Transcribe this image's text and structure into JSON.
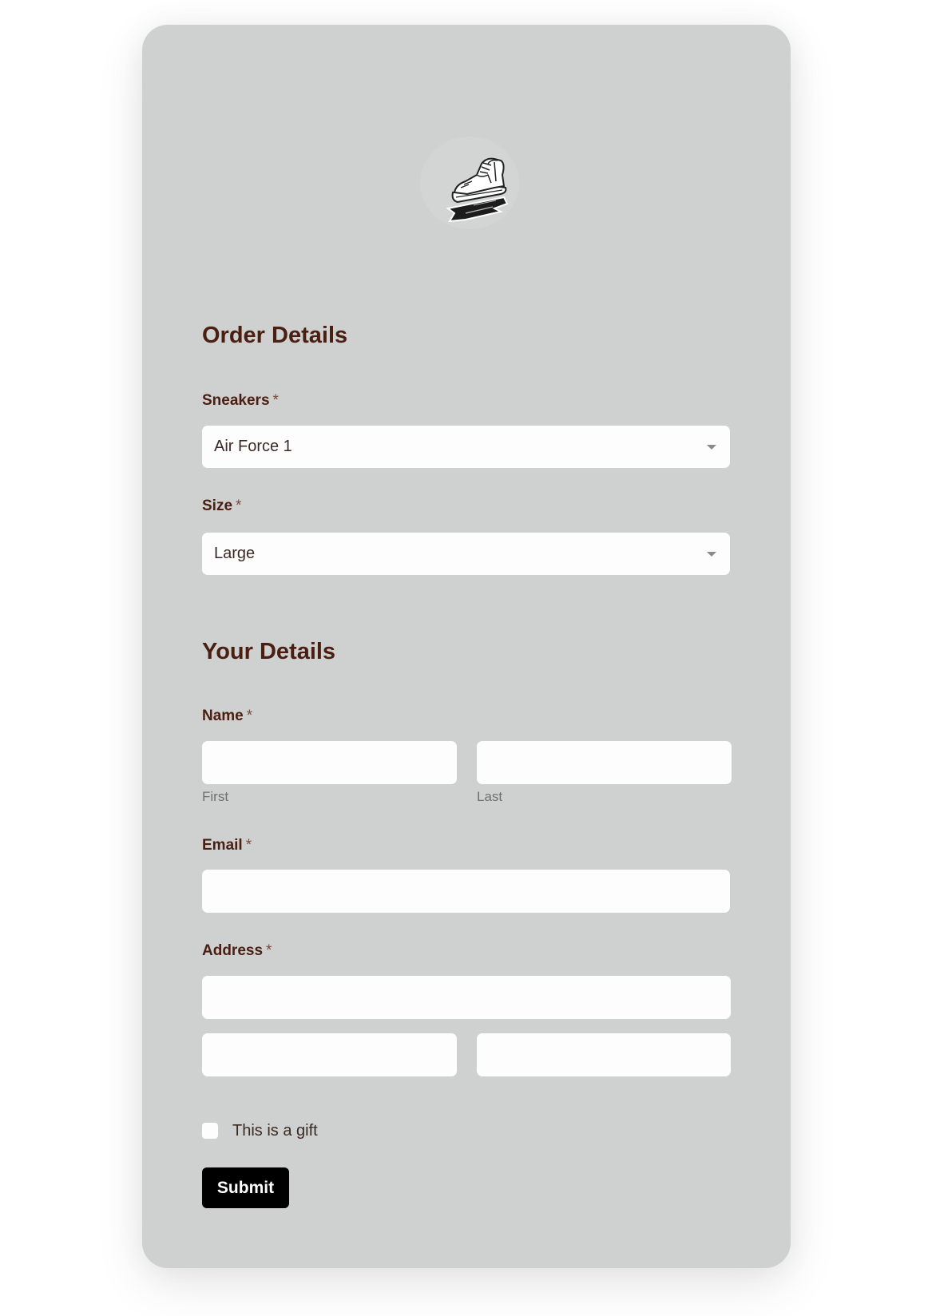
{
  "logo": {
    "icon": "sneaker-logo-icon",
    "alt": "Sneaker logo"
  },
  "order_section": {
    "title": "Order Details",
    "sneakers": {
      "label": "Sneakers",
      "required": "*",
      "value": "Air Force 1"
    },
    "size": {
      "label": "Size",
      "required": "*",
      "value": "Large"
    }
  },
  "details_section": {
    "title": "Your Details",
    "name": {
      "label": "Name",
      "required": "*",
      "first_sublabel": "First",
      "last_sublabel": "Last",
      "first_value": "",
      "last_value": ""
    },
    "email": {
      "label": "Email",
      "required": "*",
      "value": ""
    },
    "address": {
      "label": "Address",
      "required": "*",
      "line1_value": "",
      "line2_value": "",
      "line3_value": ""
    }
  },
  "gift": {
    "label": "This is a gift",
    "checked": false
  },
  "submit": {
    "label": "Submit"
  },
  "colors": {
    "card_bg": "#cfd0d0",
    "heading": "#4a1f12",
    "button_bg": "#000000",
    "input_bg": "#fdfdfd"
  }
}
